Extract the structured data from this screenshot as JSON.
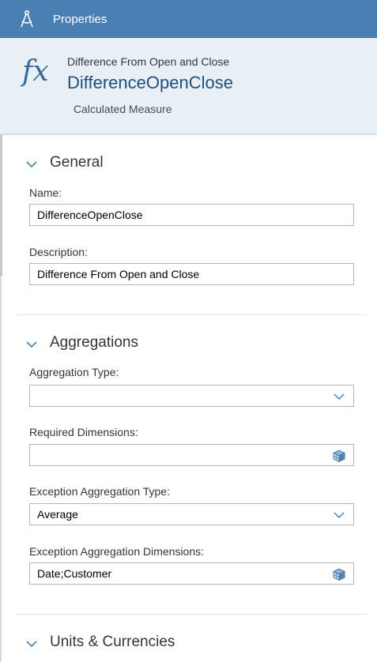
{
  "topbar": {
    "title": "Properties",
    "icon": "compass-icon"
  },
  "header": {
    "subtitle": "Difference From Open and Close",
    "name": "DifferenceOpenClose",
    "type": "Calculated Measure",
    "icon": "fx-icon"
  },
  "general": {
    "title": "General",
    "name_label": "Name:",
    "name_value": "DifferenceOpenClose",
    "description_label": "Description:",
    "description_value": "Difference From Open and Close"
  },
  "aggregations": {
    "title": "Aggregations",
    "aggregation_type_label": "Aggregation Type:",
    "aggregation_type_value": "",
    "required_dimensions_label": "Required Dimensions:",
    "required_dimensions_value": "",
    "exception_type_label": "Exception Aggregation Type:",
    "exception_type_value": "Average",
    "exception_dimensions_label": "Exception Aggregation Dimensions:",
    "exception_dimensions_value": "Date;Customer"
  },
  "units": {
    "title": "Units & Currencies"
  },
  "colors": {
    "topbar": "#4a7fb4",
    "header_bg": "#e8f0f6",
    "accent": "#1f4f7d"
  }
}
